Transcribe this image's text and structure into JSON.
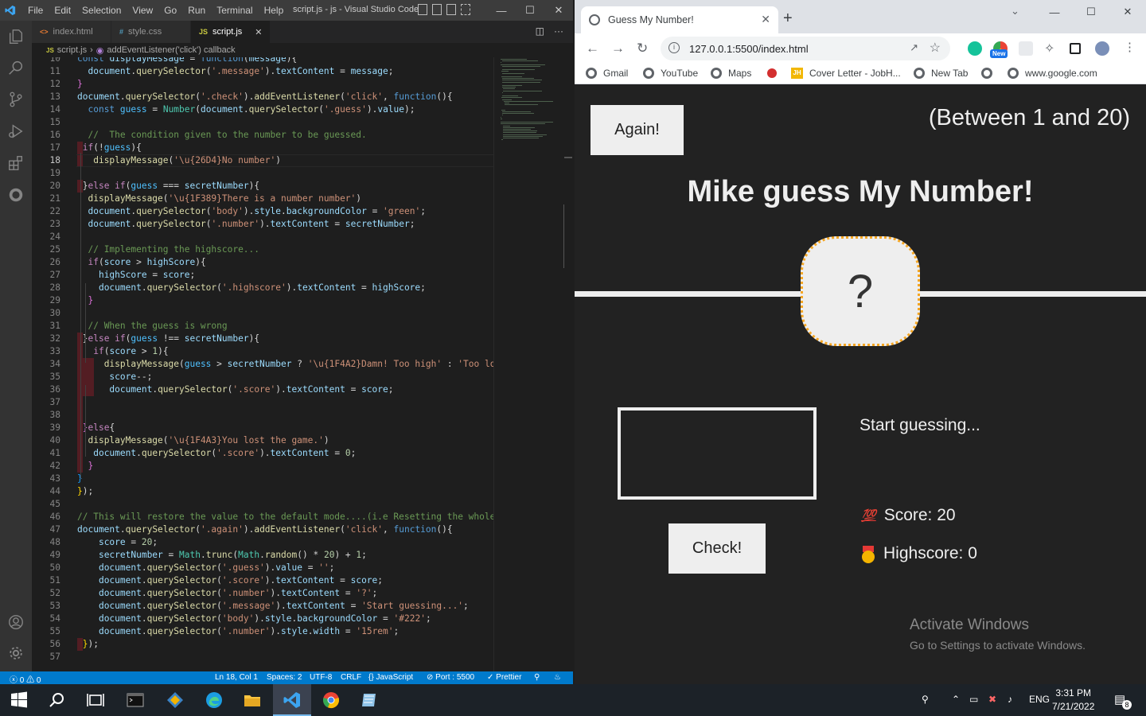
{
  "vscode": {
    "window_title": "script.js - js - Visual Studio Code",
    "menu": [
      "File",
      "Edit",
      "Selection",
      "View",
      "Go",
      "Run",
      "Terminal",
      "Help"
    ],
    "tabs": [
      {
        "label": "index.html",
        "icon": "html-file-icon"
      },
      {
        "label": "style.css",
        "icon": "css-file-icon"
      },
      {
        "label": "script.js",
        "icon": "js-file-icon",
        "active": true
      }
    ],
    "breadcrumb": {
      "file": "script.js",
      "symbol": "addEventListener('click') callback"
    },
    "status": {
      "problems": "0",
      "warnings": "0",
      "position": "Ln 18, Col 1",
      "spaces": "Spaces: 2",
      "encoding": "UTF-8",
      "eol": "CRLF",
      "language": "JavaScript",
      "port": "Port : 5500",
      "prettier": "Prettier"
    }
  },
  "code_lines": [
    {
      "n": "10",
      "html": "<span class='k2'>const</span> <span class='v'>displayMessage</span> = <span class='k2'>function</span>(<span class='v'>message</span>){"
    },
    {
      "n": "11",
      "html": "  <span class='v'>document</span>.<span class='f'>querySelector</span>(<span class='s'>'.message'</span>).<span class='v'>textContent</span> = <span class='v'>message</span>;"
    },
    {
      "n": "12",
      "html": "<span class='b1'>}</span>"
    },
    {
      "n": "13",
      "html": "<span class='v'>document</span>.<span class='f'>querySelector</span>(<span class='s'>'.check'</span>).<span class='f'>addEventListener</span>(<span class='s'>'click'</span>, <span class='k2'>function</span>(){"
    },
    {
      "n": "14",
      "html": "  <span class='k2'>const</span> <span class='c2'>guess</span> = <span class='t'>Number</span>(<span class='v'>document</span>.<span class='f'>querySelector</span>(<span class='s'>'.guess'</span>).<span class='v'>value</span>);"
    },
    {
      "n": "15",
      "html": ""
    },
    {
      "n": "16",
      "html": "  <span class='cm'>//  The condition given to the number to be guessed.</span>"
    },
    {
      "n": "17",
      "html": " <span class='k'>if</span>(!<span class='c2'>guess</span>){"
    },
    {
      "n": "18",
      "html": "   <span class='f'>displayMessage</span>(<span class='s'>'\\u{26D4}No number'</span>)"
    },
    {
      "n": "19",
      "html": ""
    },
    {
      "n": "20",
      "html": " }<span class='k'>else if</span>(<span class='c2'>guess</span> === <span class='v'>secretNumber</span>){"
    },
    {
      "n": "21",
      "html": "  <span class='f'>displayMessage</span>(<span class='s'>'\\u{1F389}There is a number number'</span>)"
    },
    {
      "n": "22",
      "html": "  <span class='v'>document</span>.<span class='f'>querySelector</span>(<span class='s'>'body'</span>).<span class='v'>style</span>.<span class='v'>backgroundColor</span> = <span class='s'>'green'</span>;"
    },
    {
      "n": "23",
      "html": "  <span class='v'>document</span>.<span class='f'>querySelector</span>(<span class='s'>'.number'</span>).<span class='v'>textContent</span> = <span class='v'>secretNumber</span>;"
    },
    {
      "n": "24",
      "html": ""
    },
    {
      "n": "25",
      "html": "  <span class='cm'>// Implementing the highscore...</span>"
    },
    {
      "n": "26",
      "html": "  <span class='k'>if</span>(<span class='v'>score</span> > <span class='v'>highScore</span>){"
    },
    {
      "n": "27",
      "html": "    <span class='v'>highScore</span> = <span class='v'>score</span>;"
    },
    {
      "n": "28",
      "html": "    <span class='v'>document</span>.<span class='f'>querySelector</span>(<span class='s'>'.highscore'</span>).<span class='v'>textContent</span> = <span class='v'>highScore</span>;"
    },
    {
      "n": "29",
      "html": "  <span class='b1'>}</span>"
    },
    {
      "n": "30",
      "html": ""
    },
    {
      "n": "31",
      "html": "  <span class='cm'>// When the guess is wrong</span>"
    },
    {
      "n": "32",
      "html": " }<span class='k'>else if</span>(<span class='c2'>guess</span> !== <span class='v'>secretNumber</span>){"
    },
    {
      "n": "33",
      "html": "   <span class='k'>if</span>(<span class='v'>score</span> > <span class='nm'>1</span>){"
    },
    {
      "n": "34",
      "html": "     <span class='f'>displayMessage</span>(<span class='c2'>guess</span> > <span class='v'>secretNumber</span> ? <span class='s'>'\\u{1F4A2}Damn! Too high'</span> : <span class='s'>'Too low va</span>"
    },
    {
      "n": "35",
      "html": "      <span class='v'>score</span>--;"
    },
    {
      "n": "36",
      "html": "      <span class='v'>document</span>.<span class='f'>querySelector</span>(<span class='s'>'.score'</span>).<span class='v'>textContent</span> = <span class='v'>score</span>;"
    },
    {
      "n": "37",
      "html": ""
    },
    {
      "n": "38",
      "html": ""
    },
    {
      "n": "39",
      "html": " <span class='b1'>}</span><span class='k'>else</span>{"
    },
    {
      "n": "40",
      "html": "  <span class='f'>displayMessage</span>(<span class='s'>'\\u{1F4A3}You lost the game.'</span>)"
    },
    {
      "n": "41",
      "html": "   <span class='v'>document</span>.<span class='f'>querySelector</span>(<span class='s'>'.score'</span>).<span class='v'>textContent</span> = <span class='nm'>0</span>;"
    },
    {
      "n": "42",
      "html": "  <span class='b1'>}</span>"
    },
    {
      "n": "43",
      "html": "<span class='b2'>}</span>"
    },
    {
      "n": "44",
      "html": "<span class='b3'>}</span>);"
    },
    {
      "n": "45",
      "html": ""
    },
    {
      "n": "46",
      "html": "<span class='cm'>// This will restore the value to the default mode....(i.e Resetting the whole pag</span>"
    },
    {
      "n": "47",
      "html": "<span class='v'>document</span>.<span class='f'>querySelector</span>(<span class='s'>'.again'</span>).<span class='f'>addEventListener</span>(<span class='s'>'click'</span>, <span class='k2'>function</span>(){"
    },
    {
      "n": "48",
      "html": "    <span class='v'>score</span> = <span class='nm'>20</span>;"
    },
    {
      "n": "49",
      "html": "    <span class='v'>secretNumber</span> = <span class='t'>Math</span>.<span class='f'>trunc</span>(<span class='t'>Math</span>.<span class='f'>random</span>() * <span class='nm'>20</span>) + <span class='nm'>1</span>;"
    },
    {
      "n": "50",
      "html": "    <span class='v'>document</span>.<span class='f'>querySelector</span>(<span class='s'>'.guess'</span>).<span class='v'>value</span> = <span class='s'>''</span>;"
    },
    {
      "n": "51",
      "html": "    <span class='v'>document</span>.<span class='f'>querySelector</span>(<span class='s'>'.score'</span>).<span class='v'>textContent</span> = <span class='v'>score</span>;"
    },
    {
      "n": "52",
      "html": "    <span class='v'>document</span>.<span class='f'>querySelector</span>(<span class='s'>'.number'</span>).<span class='v'>textContent</span> = <span class='s'>'?'</span>;"
    },
    {
      "n": "53",
      "html": "    <span class='v'>document</span>.<span class='f'>querySelector</span>(<span class='s'>'.message'</span>).<span class='v'>textContent</span> = <span class='s'>'Start guessing...'</span>;"
    },
    {
      "n": "54",
      "html": "    <span class='v'>document</span>.<span class='f'>querySelector</span>(<span class='s'>'body'</span>).<span class='v'>style</span>.<span class='v'>backgroundColor</span> = <span class='s'>'#222'</span>;"
    },
    {
      "n": "55",
      "html": "    <span class='v'>document</span>.<span class='f'>querySelector</span>(<span class='s'>'.number'</span>).<span class='v'>style</span>.<span class='v'>width</span> = <span class='s'>'15rem'</span>;"
    },
    {
      "n": "56",
      "html": " <span class='b3'>}</span>);"
    },
    {
      "n": "57",
      "html": ""
    }
  ],
  "active_line": "18",
  "chrome": {
    "tab_title": "Guess My Number!",
    "url": "127.0.0.1:5500/index.html",
    "new_badge": "New",
    "bookmarks": [
      "Gmail",
      "YouTube",
      "Maps",
      "",
      "Cover Letter - JobH...",
      "New Tab",
      "",
      "www.google.com"
    ]
  },
  "game": {
    "again_label": "Again!",
    "between": "(Between 1 and 20)",
    "title": "Mike guess My Number!",
    "number": "?",
    "guess_value": "",
    "check_label": "Check!",
    "message": "Start guessing...",
    "score_emoji": "💯",
    "score_label": "Score: 20",
    "highscore_label": "Highscore: 0",
    "accent_colors": {
      "background": "#222222",
      "text": "#eeeeee",
      "number_border": "#f5a623"
    }
  },
  "watermark": {
    "line1": "Activate Windows",
    "line2": "Go to Settings to activate Windows."
  },
  "taskbar": {
    "language": "ENG",
    "time": "3:31 PM",
    "date": "7/21/2022",
    "notifications": "8"
  }
}
